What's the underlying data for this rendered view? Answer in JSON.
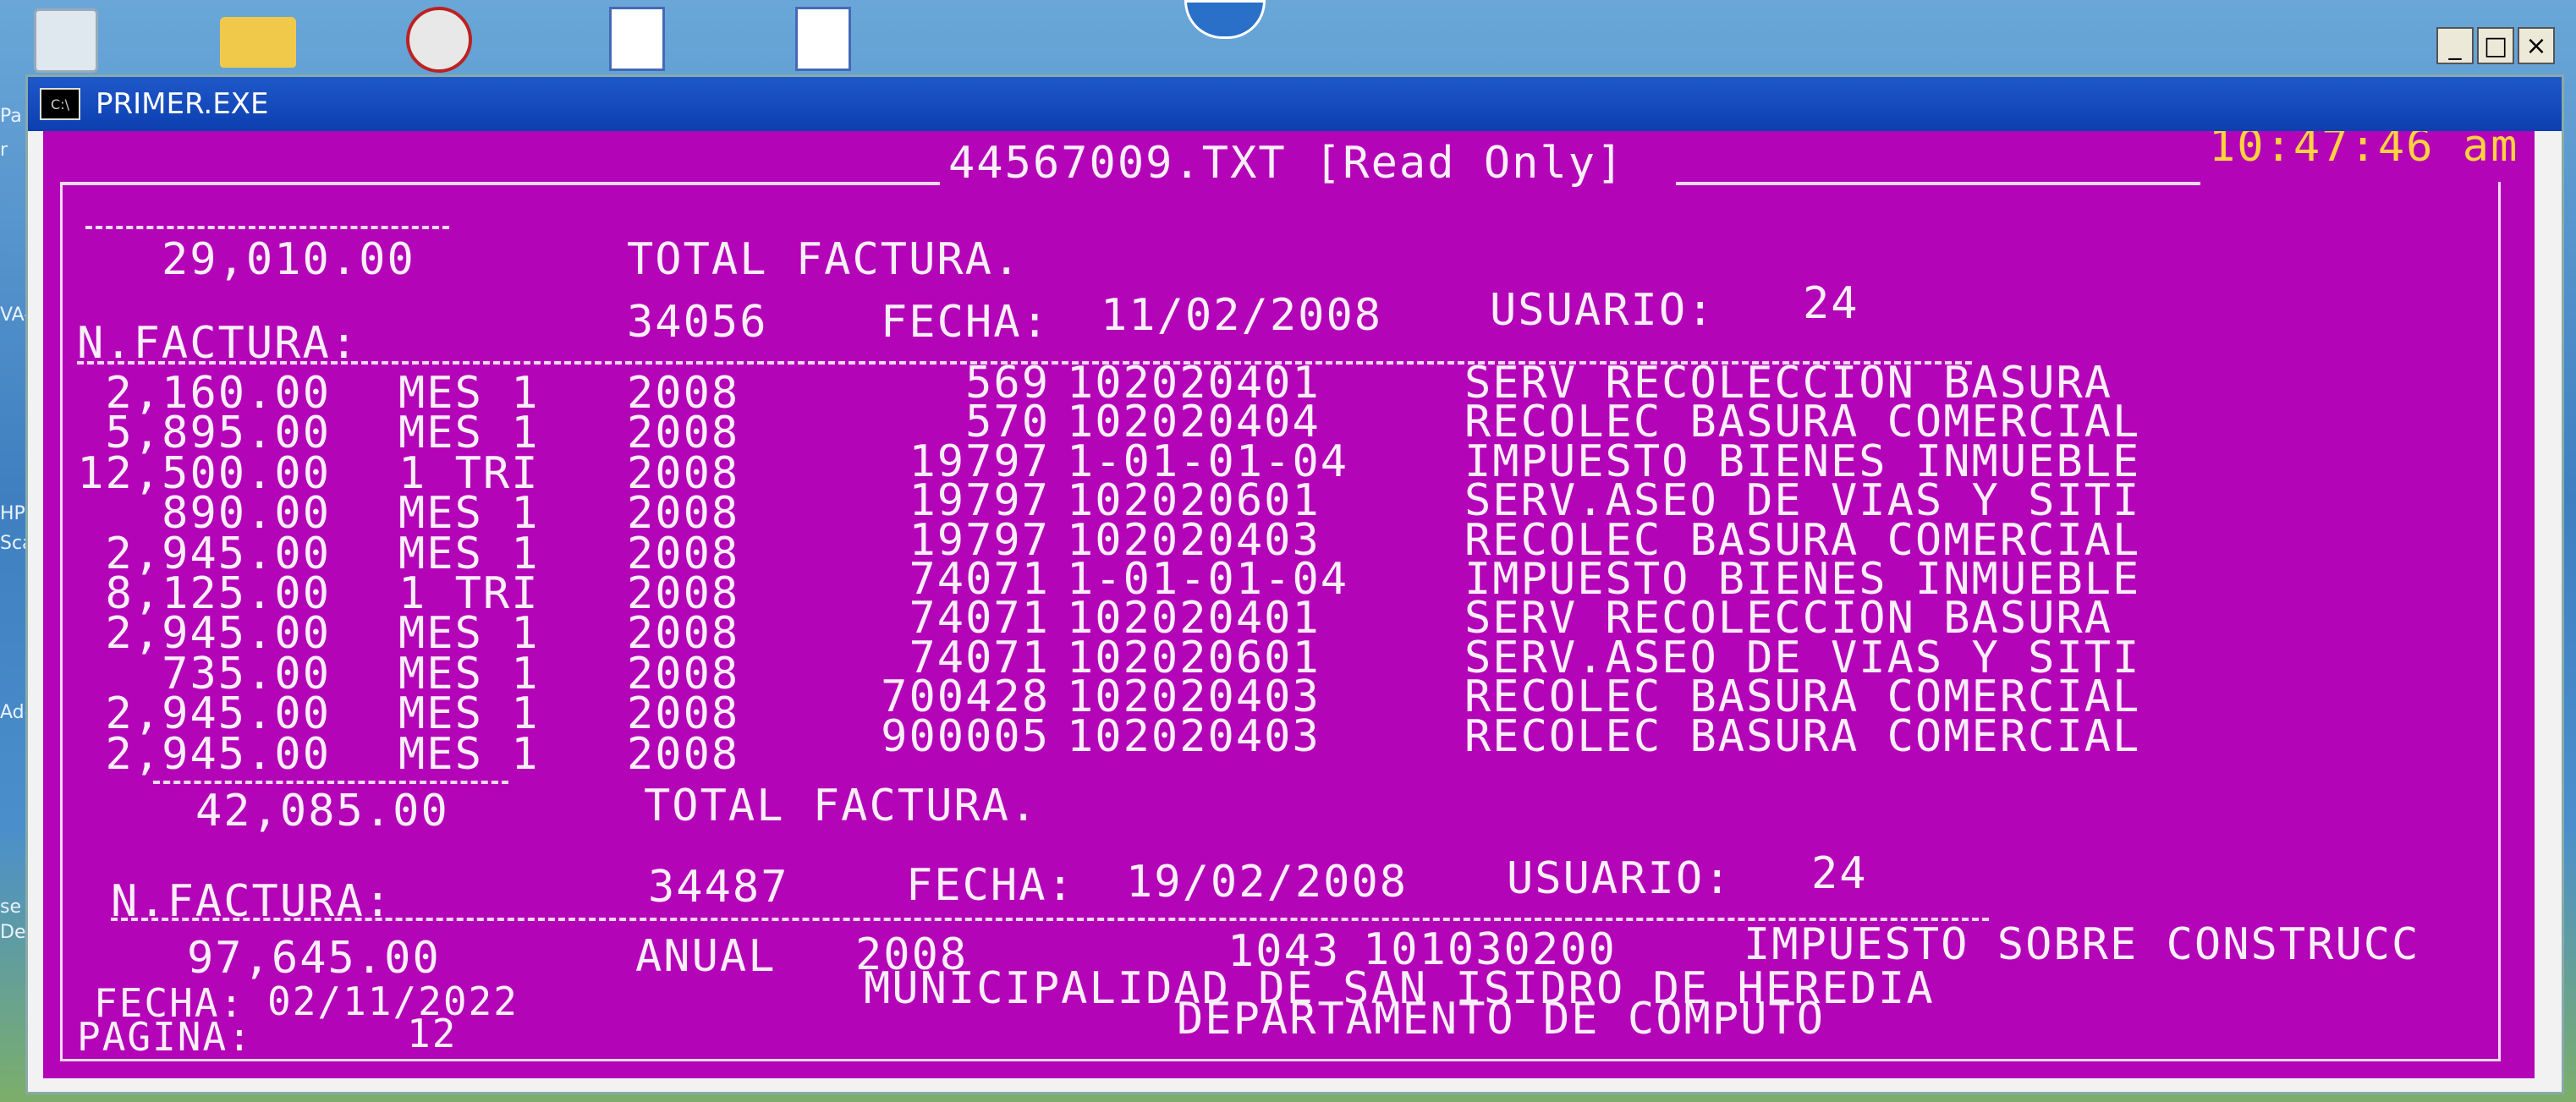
{
  "window": {
    "title": "PRIMER.EXE",
    "icon_label": "C:\\"
  },
  "header": {
    "file": "44567009.TXT [Read Only]",
    "clock": "10:47:46 am"
  },
  "desktop_labels": [
    "Pa",
    "r",
    "VA-",
    "HP",
    "Sca",
    "Ado",
    "se",
    "Des"
  ],
  "sections": [
    {
      "total": "29,010.00",
      "total_label": "TOTAL FACTURA."
    },
    {
      "invoice_label": "N.FACTURA:",
      "invoice": "34056",
      "date_label": "FECHA:",
      "date": "11/02/2008",
      "user_label": "USUARIO:",
      "user": "24"
    }
  ],
  "rows": [
    [
      "2,160.00",
      "MES 1",
      "2008",
      "569",
      "102020401",
      "SERV RECOLECCION BASURA"
    ],
    [
      "5,895.00",
      "MES 1",
      "2008",
      "570",
      "102020404",
      "RECOLEC BASURA COMERCIAL"
    ],
    [
      "12,500.00",
      "1 TRI",
      "2008",
      "19797",
      "1-01-01-04",
      "IMPUESTO BIENES INMUEBLE"
    ],
    [
      "890.00",
      "MES 1",
      "2008",
      "19797",
      "102020601",
      "SERV.ASEO DE VIAS Y SITI"
    ],
    [
      "2,945.00",
      "MES 1",
      "2008",
      "19797",
      "102020403",
      "RECOLEC BASURA COMERCIAL"
    ],
    [
      "8,125.00",
      "1 TRI",
      "2008",
      "74071",
      "1-01-01-04",
      "IMPUESTO BIENES INMUEBLE"
    ],
    [
      "2,945.00",
      "MES 1",
      "2008",
      "74071",
      "102020401",
      "SERV RECOLECCION BASURA"
    ],
    [
      "735.00",
      "MES 1",
      "2008",
      "74071",
      "102020601",
      "SERV.ASEO DE VIAS Y SITI"
    ],
    [
      "2,945.00",
      "MES 1",
      "2008",
      "700428",
      "102020403",
      "RECOLEC BASURA COMERCIAL"
    ],
    [
      "2,945.00",
      "MES 1",
      "2008",
      "900005",
      "102020403",
      "RECOLEC BASURA COMERCIAL"
    ]
  ],
  "second": {
    "total": "42,085.00",
    "total_label": "TOTAL FACTURA.",
    "invoice_label": "N.FACTURA:",
    "invoice": "34487",
    "date_label": "FECHA:",
    "date": "19/02/2008",
    "user_label": "USUARIO:",
    "user": "24",
    "row": [
      "97,645.00",
      "ANUAL",
      "2008",
      "1043",
      "101030200",
      "IMPUESTO SOBRE CONSTRUCC"
    ]
  },
  "footer": {
    "fecha_label": "FECHA:",
    "fecha": "02/11/2022",
    "pagina_label": "PAGINA:",
    "pagina": "12",
    "org": "MUNICIPALIDAD DE SAN ISIDRO DE HEREDIA",
    "dept": "DEPARTAMENTO DE COMPUTO"
  },
  "buttons": {
    "minimize": "_",
    "maximize": "□",
    "close": "×"
  }
}
